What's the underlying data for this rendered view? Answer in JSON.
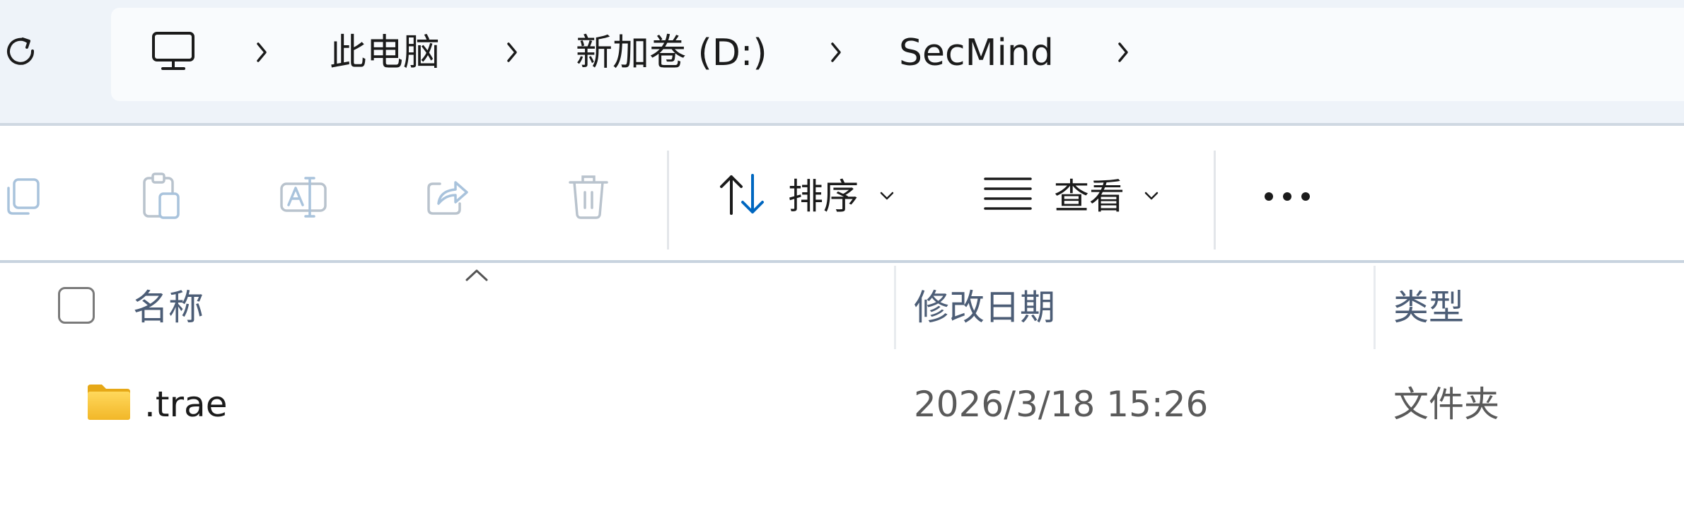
{
  "breadcrumb": {
    "root_icon": "computer-icon",
    "items": [
      {
        "label": "此电脑"
      },
      {
        "label": "新加卷 (D:)"
      },
      {
        "label": "SecMind"
      }
    ],
    "separator_icon": "chevron-right-icon"
  },
  "toolbar": {
    "icons": [
      "copy-icon",
      "paste-icon",
      "rename-icon",
      "share-icon",
      "delete-icon"
    ],
    "sort_label": "排序",
    "view_label": "查看",
    "more_icon": "more-icon"
  },
  "columns": {
    "name": "名称",
    "modified": "修改日期",
    "type": "类型"
  },
  "files": [
    {
      "name": ".trae",
      "modified": "2026/3/18 15:26",
      "type": "文件夹",
      "icon": "folder-icon"
    }
  ],
  "colors": {
    "accent": "#0067c0",
    "folder": "#f8c93e",
    "header_text": "#4c5d76",
    "topbar_bg": "#eef3f9"
  }
}
